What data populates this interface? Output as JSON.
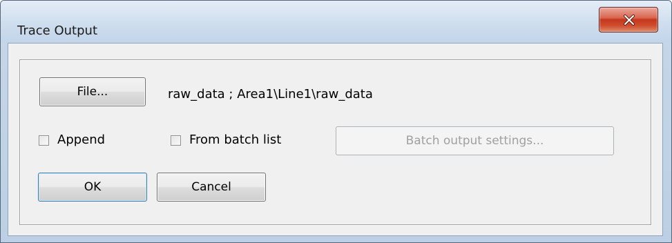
{
  "window": {
    "title": "Trace Output",
    "close_icon": "close-x-icon"
  },
  "file_button": {
    "label": "File..."
  },
  "output_path": "raw_data ; Area1\\Line1\\raw_data",
  "options": {
    "append_label": "Append",
    "append_checked": false,
    "batch_list_label": "From batch list",
    "batch_list_checked": false
  },
  "batch_settings_button": {
    "label": "Batch output settings...",
    "enabled": false
  },
  "actions": {
    "ok_label": "OK",
    "cancel_label": "Cancel"
  },
  "colors": {
    "close_button": "#c5361c",
    "dialog_background": "#f0f0f0",
    "disabled_text": "#a0a0a0"
  }
}
